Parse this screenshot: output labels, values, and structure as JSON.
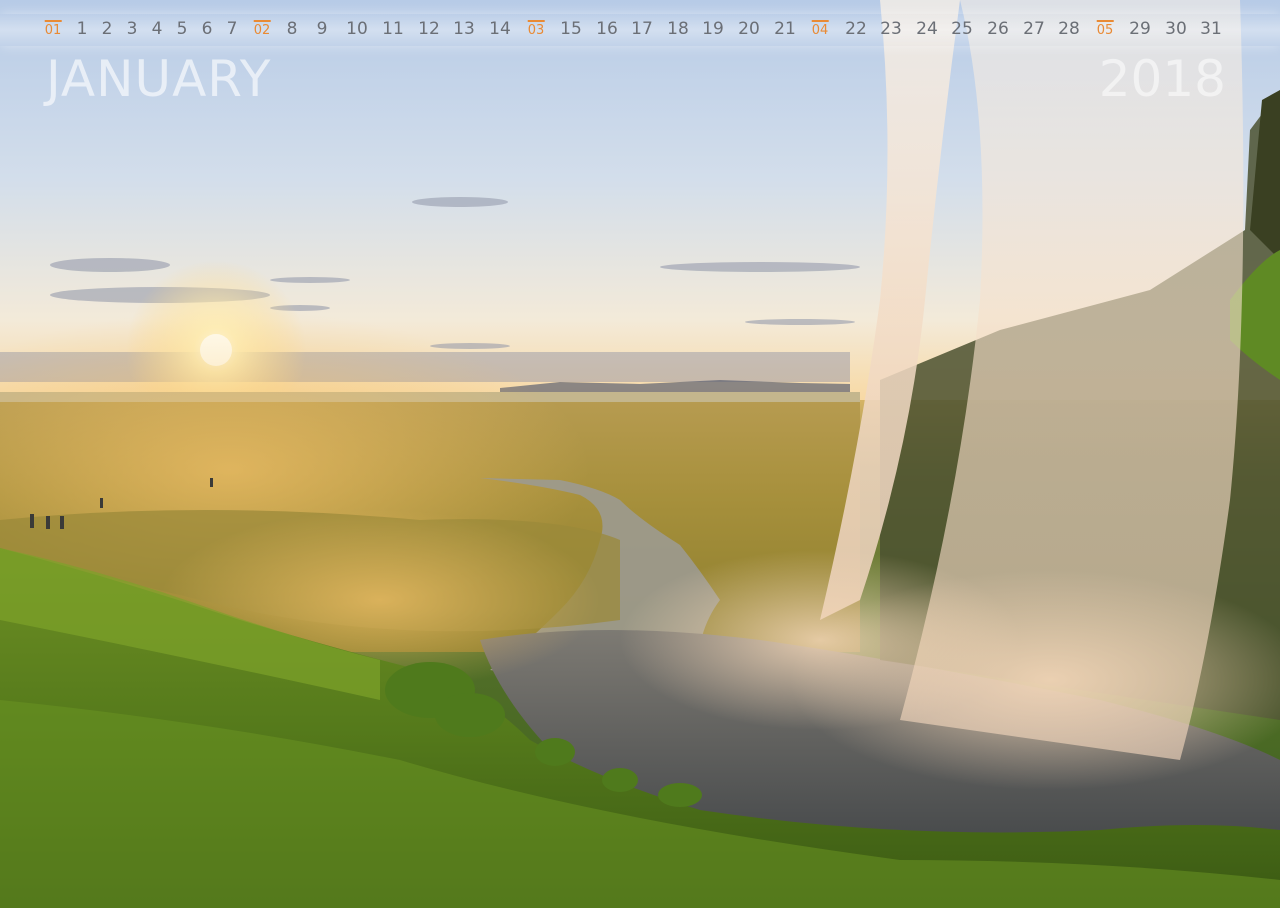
{
  "calendar": {
    "month": "JANUARY",
    "year": "2018",
    "days": [
      "1",
      "2",
      "3",
      "4",
      "5",
      "6",
      "7",
      "8",
      "9",
      "10",
      "11",
      "12",
      "13",
      "14",
      "15",
      "16",
      "17",
      "18",
      "19",
      "20",
      "21",
      "22",
      "23",
      "24",
      "25",
      "26",
      "27",
      "28",
      "29",
      "30",
      "31"
    ],
    "weeks": [
      "01",
      "02",
      "03",
      "04",
      "05"
    ],
    "week_number_color": "#e98a34",
    "day_number_color": "#6b6f76"
  },
  "photo": {
    "subject": "waterfall-at-sunset"
  }
}
